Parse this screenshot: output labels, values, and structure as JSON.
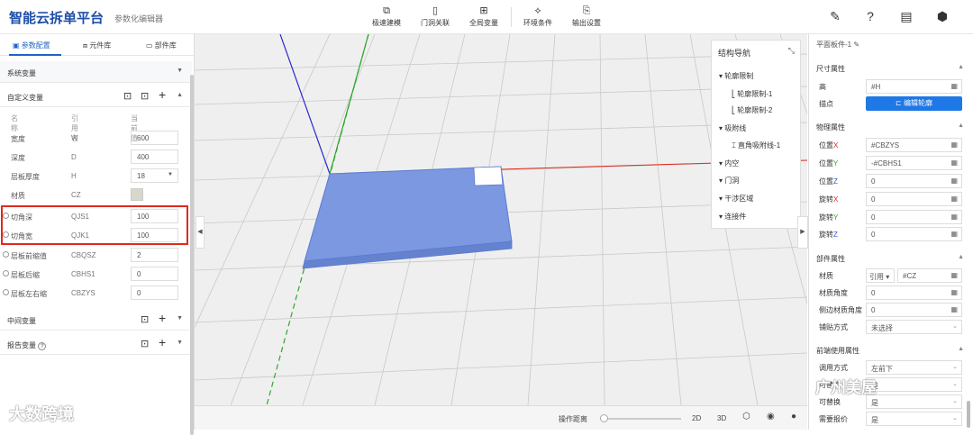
{
  "header": {
    "brand": "智能云拆单平台",
    "subtitle": "参数化编辑器",
    "tools": [
      {
        "icon": "cube-icon",
        "label": "极速建模"
      },
      {
        "icon": "door-icon",
        "label": "门洞关联"
      },
      {
        "icon": "grid-icon",
        "label": "全局变量"
      },
      {
        "icon": "env-icon",
        "label": "环境条件"
      },
      {
        "icon": "export-icon",
        "label": "输出设置"
      }
    ],
    "right_icons": [
      "pencil-icon",
      "help-icon",
      "document-icon",
      "settings-icon"
    ]
  },
  "left": {
    "tabs": [
      "参数配置",
      "元件库",
      "部件库"
    ],
    "sections": {
      "system": "系统变量",
      "custom": "自定义变量",
      "middle": "中间变量",
      "report": "报告变量"
    },
    "columns": [
      "名称",
      "引用名",
      "当前值"
    ],
    "rows": [
      {
        "name": "宽度",
        "ref": "W",
        "value": "600"
      },
      {
        "name": "深度",
        "ref": "D",
        "value": "400"
      },
      {
        "name": "层板厚度",
        "ref": "H",
        "value": "18"
      },
      {
        "name": "材质",
        "ref": "CZ",
        "value": ""
      },
      {
        "name": "切角深",
        "ref": "QJS1",
        "value": "100"
      },
      {
        "name": "切角宽",
        "ref": "QJK1",
        "value": "100"
      },
      {
        "name": "层板前缩值",
        "ref": "CBQSZ",
        "value": "2"
      },
      {
        "name": "层板后缩",
        "ref": "CBHS1",
        "value": "0"
      },
      {
        "name": "层板左右缩",
        "ref": "CBZYS",
        "value": "0"
      }
    ]
  },
  "nav": {
    "title": "结构导航",
    "items": [
      {
        "label": "轮廓限制",
        "level": 0
      },
      {
        "label": "轮廓限制-1",
        "level": 1
      },
      {
        "label": "轮廓限制-2",
        "level": 1
      },
      {
        "label": "吸附线",
        "level": 0
      },
      {
        "label": "直角吸附线-1",
        "level": 1
      },
      {
        "label": "内空",
        "level": 0
      },
      {
        "label": "门洞",
        "level": 0
      },
      {
        "label": "干涉区域",
        "level": 0
      },
      {
        "label": "连接件",
        "level": 0
      }
    ]
  },
  "bottom": {
    "distance_label": "操作距离",
    "buttons": [
      "2D",
      "3D"
    ]
  },
  "right": {
    "title": "平面板件-1",
    "sections": {
      "size": "尺寸属性",
      "physical": "物理属性",
      "component": "部件属性",
      "front": "前端使用属性"
    },
    "size_rows": [
      {
        "label": "高",
        "value": "#H"
      },
      {
        "label": "描点",
        "button": "编辑轮廓"
      }
    ],
    "physical_rows": [
      {
        "label": "位置",
        "axis": "X",
        "value": "#CBZYS"
      },
      {
        "label": "位置",
        "axis": "Y",
        "value": "-#CBHS1"
      },
      {
        "label": "位置",
        "axis": "Z",
        "value": "0"
      },
      {
        "label": "旋转",
        "axis": "X",
        "value": "0"
      },
      {
        "label": "旋转",
        "axis": "Y",
        "value": "0"
      },
      {
        "label": "旋转",
        "axis": "Z",
        "value": "0"
      }
    ],
    "component_rows": [
      {
        "label": "材质",
        "mode": "引用",
        "value": "#CZ"
      },
      {
        "label": "材质角度",
        "value": "0"
      },
      {
        "label": "侧边材质角度",
        "value": "0"
      },
      {
        "label": "铺贴方式",
        "value": "未选择"
      }
    ],
    "front_rows": [
      {
        "label": "调用方式",
        "value": "左前下"
      },
      {
        "label": "可替换",
        "value": "是"
      },
      {
        "label": "可替换",
        "value": "是"
      },
      {
        "label": "需要报价",
        "value": "是"
      }
    ]
  },
  "watermarks": {
    "left": "大数跨境",
    "right": "广州美屋"
  },
  "colors": {
    "brand": "#1f4fa8",
    "accent": "#1e78e6",
    "highlight_box": "#e0291c",
    "board": "#7b98e0",
    "axis_x": "#e0291c",
    "axis_y": "#2da82d",
    "axis_z": "#2a2ad0"
  }
}
